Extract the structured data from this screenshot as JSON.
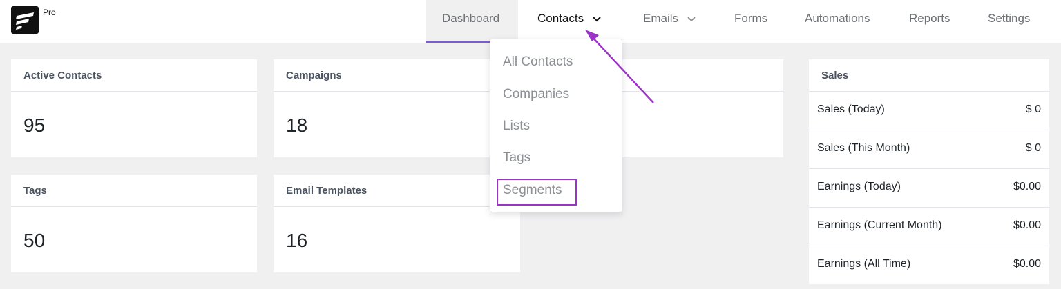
{
  "brand": {
    "badge": "Pro"
  },
  "nav": {
    "items": [
      {
        "label": "Dashboard"
      },
      {
        "label": "Contacts"
      },
      {
        "label": "Emails"
      },
      {
        "label": "Forms"
      },
      {
        "label": "Automations"
      },
      {
        "label": "Reports"
      },
      {
        "label": "Settings"
      }
    ]
  },
  "cards": [
    {
      "title": "Active Contacts",
      "value": "95"
    },
    {
      "title": "Campaigns",
      "value": "18"
    },
    {
      "title": "Tags",
      "value": "50"
    },
    {
      "title": "Email Templates",
      "value": "16"
    }
  ],
  "sales": {
    "title": "Sales",
    "rows": [
      {
        "label": "Sales (Today)",
        "value": "$ 0"
      },
      {
        "label": "Sales (This Month)",
        "value": "$ 0"
      },
      {
        "label": "Earnings (Today)",
        "value": "$0.00"
      },
      {
        "label": "Earnings (Current Month)",
        "value": "$0.00"
      },
      {
        "label": "Earnings (All Time)",
        "value": "$0.00"
      }
    ]
  },
  "dropdown": {
    "items": [
      {
        "label": "All Contacts"
      },
      {
        "label": "Companies"
      },
      {
        "label": "Lists"
      },
      {
        "label": "Tags"
      },
      {
        "label": "Segments"
      }
    ]
  },
  "colors": {
    "accent": "#7e5bd6",
    "annotation": "#9b33c7"
  },
  "icons": {
    "chevron": "chevron-down-icon",
    "logo": "fluentcrm-logo-icon",
    "annotation": "annotation-arrow-icon"
  }
}
